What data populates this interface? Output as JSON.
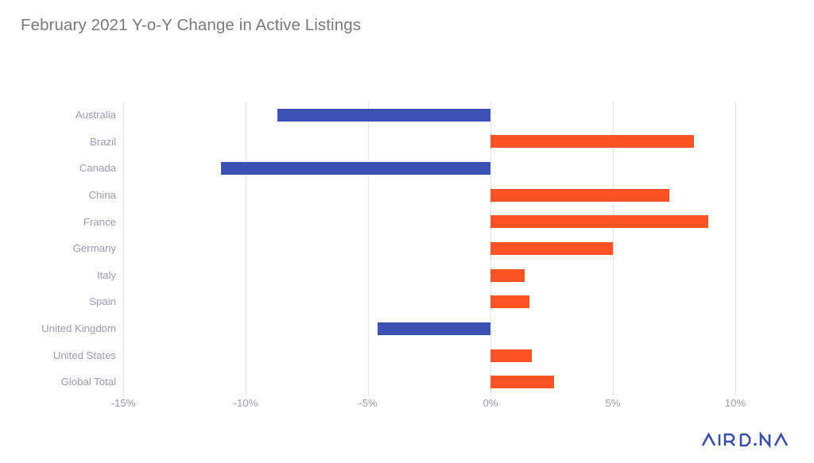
{
  "chart_data": {
    "type": "bar",
    "orientation": "horizontal",
    "title": "February 2021 Y-o-Y Change in Active Listings",
    "xlabel": "",
    "ylabel": "",
    "xlim": [
      -15,
      10
    ],
    "xticks": [
      -15,
      -10,
      -5,
      0,
      5,
      10
    ],
    "xtick_labels": [
      "-15%",
      "-10%",
      "-5%",
      "0%",
      "5%",
      "10%"
    ],
    "grid": "vertical",
    "legend": "none",
    "value_unit": "percent",
    "categories": [
      "Australia",
      "Brazil",
      "Canada",
      "China",
      "France",
      "Germany",
      "Italy",
      "Spain",
      "United Kingdom",
      "United States",
      "Global Total"
    ],
    "values": [
      -8.7,
      8.3,
      -11.0,
      7.3,
      8.9,
      5.0,
      1.4,
      1.6,
      -4.6,
      1.7,
      2.6
    ],
    "bars": [
      {
        "category": "Australia",
        "value": -8.7,
        "sign": "negative",
        "color": "#3c52b2"
      },
      {
        "category": "Brazil",
        "value": 8.3,
        "sign": "positive",
        "color": "#fb5321"
      },
      {
        "category": "Canada",
        "value": -11.0,
        "sign": "negative",
        "color": "#3c52b2"
      },
      {
        "category": "China",
        "value": 7.3,
        "sign": "positive",
        "color": "#fb5321"
      },
      {
        "category": "France",
        "value": 8.9,
        "sign": "positive",
        "color": "#fb5321"
      },
      {
        "category": "Germany",
        "value": 5.0,
        "sign": "positive",
        "color": "#fb5321"
      },
      {
        "category": "Italy",
        "value": 1.4,
        "sign": "positive",
        "color": "#fb5321"
      },
      {
        "category": "Spain",
        "value": 1.6,
        "sign": "positive",
        "color": "#fb5321"
      },
      {
        "category": "United Kingdom",
        "value": -4.6,
        "sign": "negative",
        "color": "#3c52b2"
      },
      {
        "category": "United States",
        "value": 1.7,
        "sign": "positive",
        "color": "#fb5321"
      },
      {
        "category": "Global Total",
        "value": 2.6,
        "sign": "positive",
        "color": "#fb5321"
      }
    ],
    "colors": {
      "positive": "#fb5321",
      "negative": "#3c52b2",
      "gridline": "#e6e6ea",
      "tick_text": "#9b9bb4",
      "title_text": "#7a7a7a",
      "background": "#ffffff"
    }
  },
  "branding": {
    "logo_text": "AIRDNA",
    "logo_color": "#3a4fa8"
  }
}
